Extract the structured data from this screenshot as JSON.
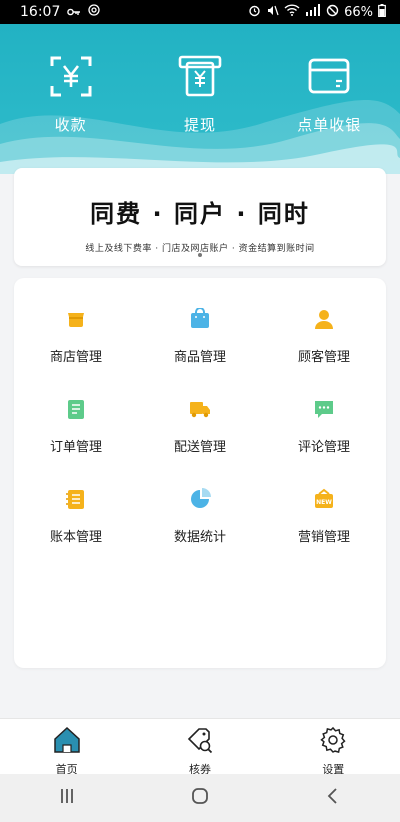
{
  "status_bar": {
    "time": "16:07",
    "battery": "66%"
  },
  "header": {
    "actions": [
      {
        "label": "收款",
        "icon": "collect-money-icon"
      },
      {
        "label": "提现",
        "icon": "withdraw-icon"
      },
      {
        "label": "点单收银",
        "icon": "cashier-icon"
      }
    ],
    "background_color": "#22b2c3"
  },
  "banner": {
    "title": "同费 · 同户 · 同时",
    "subtitle": "线上及线下费率  ·  门店及网店账户  ·  资金结算到账时间"
  },
  "menu": {
    "items": [
      {
        "label": "商店管理",
        "icon": "store-icon",
        "color": "#f5b21b"
      },
      {
        "label": "商品管理",
        "icon": "product-bag-icon",
        "color": "#4cb3e6"
      },
      {
        "label": "顾客管理",
        "icon": "customer-icon",
        "color": "#f5b21b"
      },
      {
        "label": "订单管理",
        "icon": "order-doc-icon",
        "color": "#5dcb8a"
      },
      {
        "label": "配送管理",
        "icon": "delivery-truck-icon",
        "color": "#f5b21b"
      },
      {
        "label": "评论管理",
        "icon": "comment-icon",
        "color": "#5dcb8a"
      },
      {
        "label": "账本管理",
        "icon": "ledger-icon",
        "color": "#f5b21b"
      },
      {
        "label": "数据统计",
        "icon": "pie-chart-icon",
        "color": "#4cb3e6"
      },
      {
        "label": "营销管理",
        "icon": "marketing-new-icon",
        "color": "#f5b21b"
      }
    ]
  },
  "bottom_nav": {
    "items": [
      {
        "label": "首页",
        "icon": "home-icon"
      },
      {
        "label": "核券",
        "icon": "coupon-verify-icon"
      },
      {
        "label": "设置",
        "icon": "settings-gear-icon"
      }
    ]
  }
}
